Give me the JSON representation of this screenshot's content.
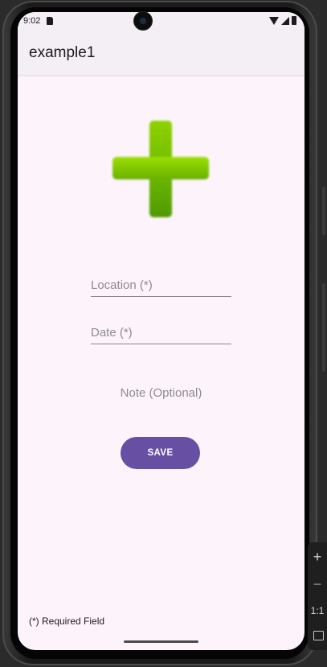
{
  "status_bar": {
    "time": "9:02"
  },
  "app_bar": {
    "title": "example1"
  },
  "image": {
    "icon": "plus-icon",
    "color": "#6fb800"
  },
  "form": {
    "location": {
      "value": "",
      "placeholder": "Location (*)"
    },
    "date": {
      "value": "",
      "placeholder": "Date (*)"
    },
    "note": {
      "value": "",
      "placeholder": "Note (Optional)"
    },
    "save_label": "SAVE"
  },
  "footer": {
    "required_note": "(*) Required Field"
  },
  "emulator_toolbar": {
    "zoom_in": "+",
    "zoom_out": "−",
    "actual_size": "1:1"
  },
  "colors": {
    "primary": "#6750a4",
    "background": "#fdf4fb",
    "app_bar": "#f4eff4"
  }
}
